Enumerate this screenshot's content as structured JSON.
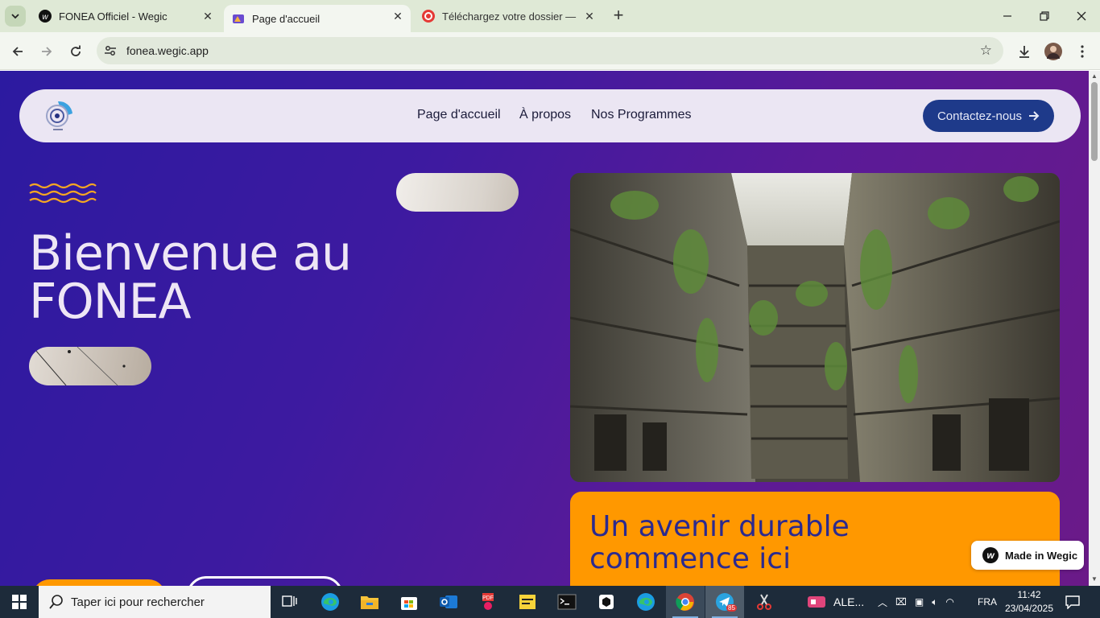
{
  "browser": {
    "tabs": [
      {
        "title": "FONEA Officiel - Wegic",
        "close": "✕"
      },
      {
        "title": "Page d'accueil",
        "close": "✕"
      },
      {
        "title": "Téléchargez votre dossier — Co",
        "close": "✕"
      }
    ],
    "new_tab": "+",
    "url": "fonea.wegic.app"
  },
  "site": {
    "nav": {
      "links": [
        "Page d'accueil",
        "À propos",
        "Nos Programmes"
      ],
      "contact": "Contactez-nous"
    },
    "hero": {
      "title": "Bienvenue au FONEA"
    },
    "card": {
      "text": "Un avenir durable commence ici"
    },
    "badge": "Made in Wegic"
  },
  "taskbar": {
    "search_placeholder": "Taper ici pour rechercher",
    "tray_app_label": "ALE...",
    "language": "FRA",
    "time": "11:42",
    "date": "23/04/2025",
    "telegram_badge": "85"
  },
  "colors": {
    "accent_orange": "#ff9800",
    "nav_button": "#1e3a8a",
    "hero_gradient_start": "#2c1aa0",
    "hero_gradient_end": "#6b1a88"
  }
}
